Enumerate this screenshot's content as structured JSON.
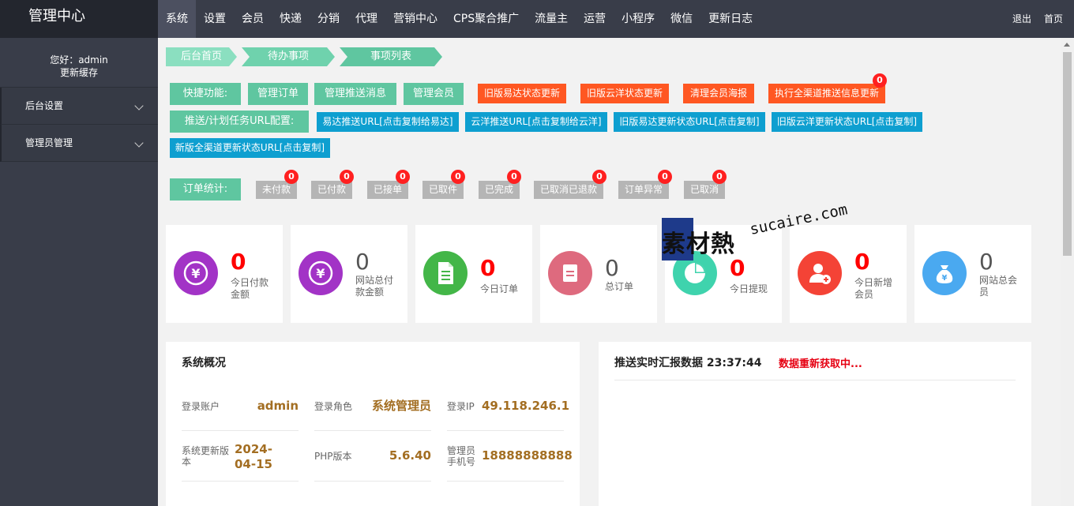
{
  "header": {
    "brand": "管理中心",
    "nav": [
      "系统",
      "设置",
      "会员",
      "快递",
      "分销",
      "代理",
      "营销中心",
      "CPS聚合推广",
      "流量主",
      "运营",
      "小程序",
      "微信",
      "更新日志"
    ],
    "active_nav": "系统",
    "logout": "退出",
    "home": "首页"
  },
  "sidebar": {
    "greeting": "您好：admin",
    "refresh_cache": "更新缓存",
    "items": [
      "后台设置",
      "管理员管理"
    ]
  },
  "breadcrumb": [
    "后台首页",
    "待办事项",
    "事项列表"
  ],
  "quick": {
    "label": "快捷功能:",
    "green_buttons": [
      "管理订单",
      "管理推送消息",
      "管理会员"
    ],
    "orange_buttons": [
      "旧版易达状态更新",
      "旧版云洋状态更新",
      "清理会员海报",
      "执行全渠道推送信息更新"
    ],
    "push_badge": "0"
  },
  "push_config": {
    "label": "推送/计划任务URL配置:",
    "buttons": [
      "易达推送URL[点击复制给易达]",
      "云洋推送URL[点击复制给云洋]",
      "旧版易达更新状态URL[点击复制]",
      "旧版云洋更新状态URL[点击复制]",
      "新版全渠道更新状态URL[点击复制]"
    ]
  },
  "order_stats": {
    "label": "订单统计:",
    "items": [
      {
        "label": "未付款",
        "count": "0"
      },
      {
        "label": "已付款",
        "count": "0"
      },
      {
        "label": "已接单",
        "count": "0"
      },
      {
        "label": "已取件",
        "count": "0"
      },
      {
        "label": "已完成",
        "count": "0"
      },
      {
        "label": "已取消已退款",
        "count": "0"
      },
      {
        "label": "订单异常",
        "count": "0"
      },
      {
        "label": "已取消",
        "count": "0"
      }
    ]
  },
  "stat_cards": [
    {
      "value": "0",
      "label": "今日付款金额",
      "color": "#a233c6",
      "icon": "yen-icon",
      "highlight": true
    },
    {
      "value": "0",
      "label": "网站总付款金额",
      "color": "#a233c6",
      "icon": "yen-icon",
      "highlight": false
    },
    {
      "value": "0",
      "label": "今日订单",
      "color": "#43b648",
      "icon": "document-icon",
      "highlight": true
    },
    {
      "value": "0",
      "label": "总订单",
      "color": "#de6a7e",
      "icon": "list-icon",
      "highlight": false
    },
    {
      "value": "0",
      "label": "今日提现",
      "color": "#3fd3ad",
      "icon": "pie-chart-icon",
      "highlight": true
    },
    {
      "value": "0",
      "label": "今日新增会员",
      "color": "#f44336",
      "icon": "add-user-icon",
      "highlight": true
    },
    {
      "value": "0",
      "label": "网站总会员",
      "color": "#4aa9f0",
      "icon": "money-bag-icon",
      "highlight": false
    }
  ],
  "overview": {
    "title": "系统概况",
    "rows": [
      [
        {
          "label": "登录账户",
          "value": "admin"
        },
        {
          "label": "登录角色",
          "value": "系统管理员"
        },
        {
          "label": "登录IP",
          "value": "49.118.246.1"
        }
      ],
      [
        {
          "label": "系统更新版本",
          "value": "2024-04-15"
        },
        {
          "label": "PHP版本",
          "value": "5.6.40"
        },
        {
          "label": "管理员手机号",
          "value": "18888888888"
        }
      ]
    ]
  },
  "realtime": {
    "title": "推送实时汇报数据 23:37:44",
    "status": "数据重新获取中..."
  },
  "watermark": {
    "cn": "素材熱",
    "en": "sucaire.com"
  }
}
